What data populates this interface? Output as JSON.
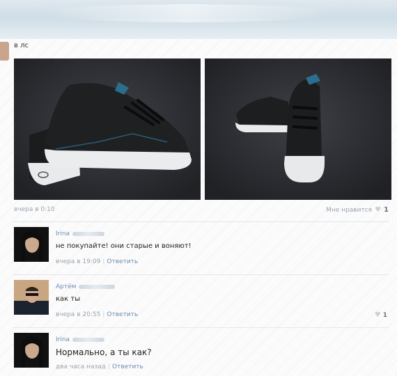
{
  "post": {
    "text": "в лс",
    "time": "вчера в 0:10",
    "like_label": "Мне нравится",
    "like_count": "1"
  },
  "comments": [
    {
      "name": "Irina",
      "text": "не покупайте! они старые и воняют!",
      "time": "вчера в 19:09",
      "reply": "Ответить"
    },
    {
      "name": "Артём",
      "text": "как ты",
      "time": "вчера в 20:55",
      "reply": "Ответить",
      "likes": "1"
    },
    {
      "name": "Irina",
      "text": "Нормально, а ты как?",
      "time": "два часа назад",
      "reply": "Ответить"
    }
  ],
  "icons": {
    "heart": "heart-icon"
  }
}
